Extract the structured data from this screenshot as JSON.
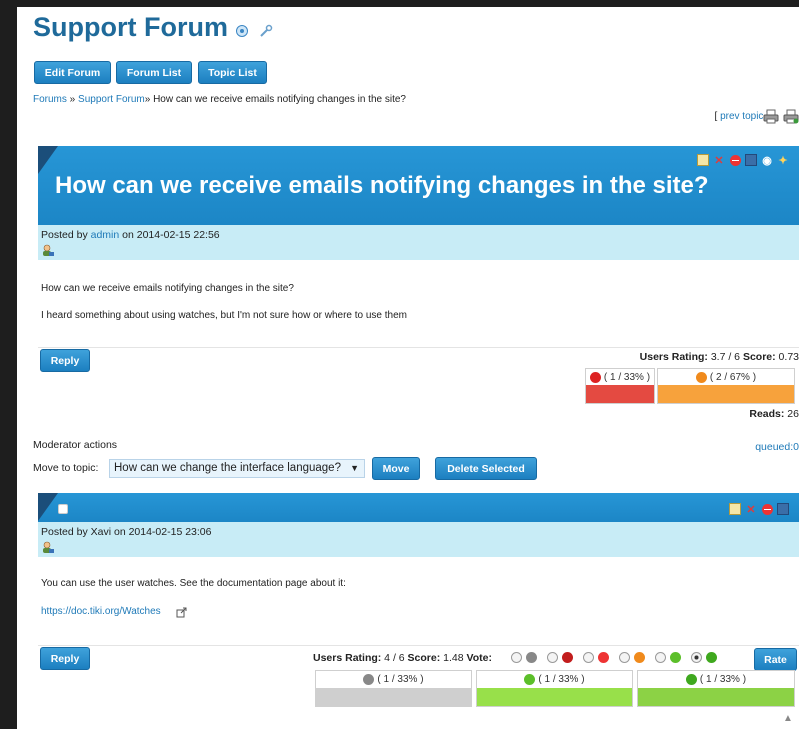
{
  "forum": {
    "title": "Support Forum"
  },
  "toolbar": {
    "edit_forum": "Edit Forum",
    "forum_list": "Forum List",
    "topic_list": "Topic List"
  },
  "breadcrumb": {
    "forums": "Forums",
    "sep1": " » ",
    "support_forum": "Support Forum",
    "sep2": "» ",
    "current": "How can we receive emails notifying changes in the site?"
  },
  "topic_nav": {
    "open": "[ ",
    "prev": "prev topic",
    "close": " ]"
  },
  "topic": {
    "title": "How can we receive emails notifying changes in the site?",
    "posted_by_prefix": "Posted by ",
    "author": "admin",
    "posted_on": " on 2014-02-15 22:56",
    "body_line1": "How can we receive emails notifying changes in the site?",
    "body_line2": "I heard something about using watches, but I'm not sure how or where to use them",
    "reply": "Reply",
    "rating_label": "Users Rating:",
    "rating_value": " 3.7 / 6 ",
    "score_label": "Score:",
    "score_value": " 0.73",
    "ratings": [
      {
        "text": "( 1 / 33% )",
        "icon": "red-frown-face-icon",
        "color": "#e44a41",
        "fraction": 0.33
      },
      {
        "text": "( 2 / 67% )",
        "icon": "orange-neutral-face-icon",
        "color": "#f7a23c",
        "fraction": 0.67
      }
    ],
    "reads_label": "Reads:",
    "reads_value": " 26"
  },
  "moderator": {
    "heading": "Moderator actions",
    "queued": "queued:0",
    "move_label": "Move to topic:",
    "move_value": "How can we change the interface language?",
    "move_button": "Move",
    "delete_button": "Delete Selected"
  },
  "reply_post": {
    "posted_by_prefix": "Posted by ",
    "author": "Xavi",
    "posted_on": " on 2014-02-15 23:06",
    "body_line1": "You can use the user watches. See the documentation page about it:",
    "link": "https://doc.tiki.org/Watches",
    "reply": "Reply",
    "rating_label": "Users Rating:",
    "rating_value": " 4 / 6 ",
    "score_label": "Score:",
    "score_value": " 1.48 ",
    "vote_label": "Vote:",
    "rate_button": "Rate",
    "ratings": [
      {
        "text": "( 1 / 33% )",
        "icon": "gray-face-icon",
        "color": "#cfcfcf",
        "fraction": 0.33
      },
      {
        "text": "( 1 / 33% )",
        "icon": "green-smile-face-icon",
        "color": "#98e04a",
        "fraction": 0.33
      },
      {
        "text": "( 1 / 33% )",
        "icon": "green-smile-face-icon",
        "color": "#8cd245",
        "fraction": 0.33
      }
    ],
    "vote_options": [
      "gray-face-icon",
      "red-angry-face-icon",
      "red-frown-face-icon",
      "orange-neutral-face-icon",
      "green-smile-face-icon",
      "green-grin-face-icon"
    ],
    "vote_selected": 5
  },
  "colors": {
    "accent": "#1f7ab8",
    "banner": "#2796d6",
    "meta_bg": "#c8ecf6"
  }
}
